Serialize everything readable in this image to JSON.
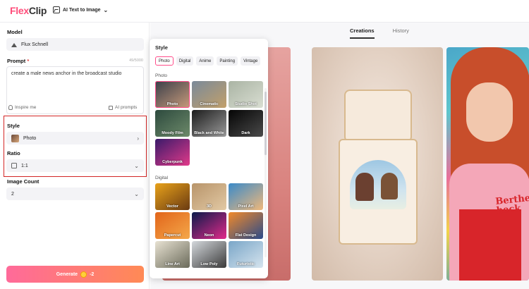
{
  "header": {
    "logo_part1": "Flex",
    "logo_part2": "Clip",
    "tool_name": "AI Text to Image"
  },
  "left_panel": {
    "model_label": "Model",
    "model_value": "Flux Schnell",
    "prompt_label": "Prompt",
    "prompt_required": "*",
    "prompt_counter": "49/5000",
    "prompt_text": "create a male news anchor in the broadcast studio",
    "inspire_me": "Inspire me",
    "ai_prompts": "AI prompts",
    "style_label": "Style",
    "style_value": "Photo",
    "ratio_label": "Ratio",
    "ratio_value": "1:1",
    "image_count_label": "Image Count",
    "image_count_value": "2",
    "generate_label": "Generate",
    "generate_cost": "-2"
  },
  "right_panel": {
    "tabs": [
      {
        "label": "Creations",
        "active": true
      },
      {
        "label": "History",
        "active": false
      }
    ],
    "image3_text": "Berther\nheck"
  },
  "style_popup": {
    "title": "Style",
    "chips": [
      {
        "label": "Photo",
        "active": true
      },
      {
        "label": "Digital",
        "active": false
      },
      {
        "label": "Anime",
        "active": false
      },
      {
        "label": "Painting",
        "active": false
      },
      {
        "label": "Vintage",
        "active": false
      }
    ],
    "section_photo": "Photo",
    "photo_tiles": [
      {
        "label": "Photo",
        "selected": true,
        "c1": "#3a3f4a",
        "c2": "#c89a7a"
      },
      {
        "label": "Cinematic",
        "selected": false,
        "c1": "#7a8a9a",
        "c2": "#c2a06a"
      },
      {
        "label": "Studio Shot",
        "selected": false,
        "c1": "#aab4a4",
        "c2": "#d9ded2"
      },
      {
        "label": "Moody Film",
        "selected": false,
        "c1": "#2d4a3e",
        "c2": "#6d8a6a"
      },
      {
        "label": "Black and White",
        "selected": false,
        "c1": "#1c1c1c",
        "c2": "#9a9a9a"
      },
      {
        "label": "Dark",
        "selected": false,
        "c1": "#050505",
        "c2": "#4a4a4a"
      },
      {
        "label": "Cyberpunk",
        "selected": false,
        "c1": "#3a1a6a",
        "c2": "#e23a8a"
      }
    ],
    "section_digital": "Digital",
    "digital_tiles": [
      {
        "label": "Vector",
        "selected": false,
        "c1": "#e8a21a",
        "c2": "#6a3a12"
      },
      {
        "label": "3D",
        "selected": false,
        "c1": "#b8946a",
        "c2": "#e2c9a4"
      },
      {
        "label": "Pixel Art",
        "selected": false,
        "c1": "#3a8ac9",
        "c2": "#f0b87a"
      },
      {
        "label": "Papercut",
        "selected": false,
        "c1": "#e2651a",
        "c2": "#f4a84a"
      },
      {
        "label": "Neon",
        "selected": false,
        "c1": "#0a1a4a",
        "c2": "#e22a8a"
      },
      {
        "label": "Flat Design",
        "selected": false,
        "c1": "#f28a2a",
        "c2": "#2a4a8a"
      },
      {
        "label": "Line Art",
        "selected": false,
        "c1": "#e8e2d2",
        "c2": "#6a6a5a"
      },
      {
        "label": "Low Poly",
        "selected": false,
        "c1": "#d4d8dc",
        "c2": "#3a3a3a"
      },
      {
        "label": "Futuristic",
        "selected": false,
        "c1": "#7aa6c8",
        "c2": "#d6e4ee"
      }
    ]
  }
}
